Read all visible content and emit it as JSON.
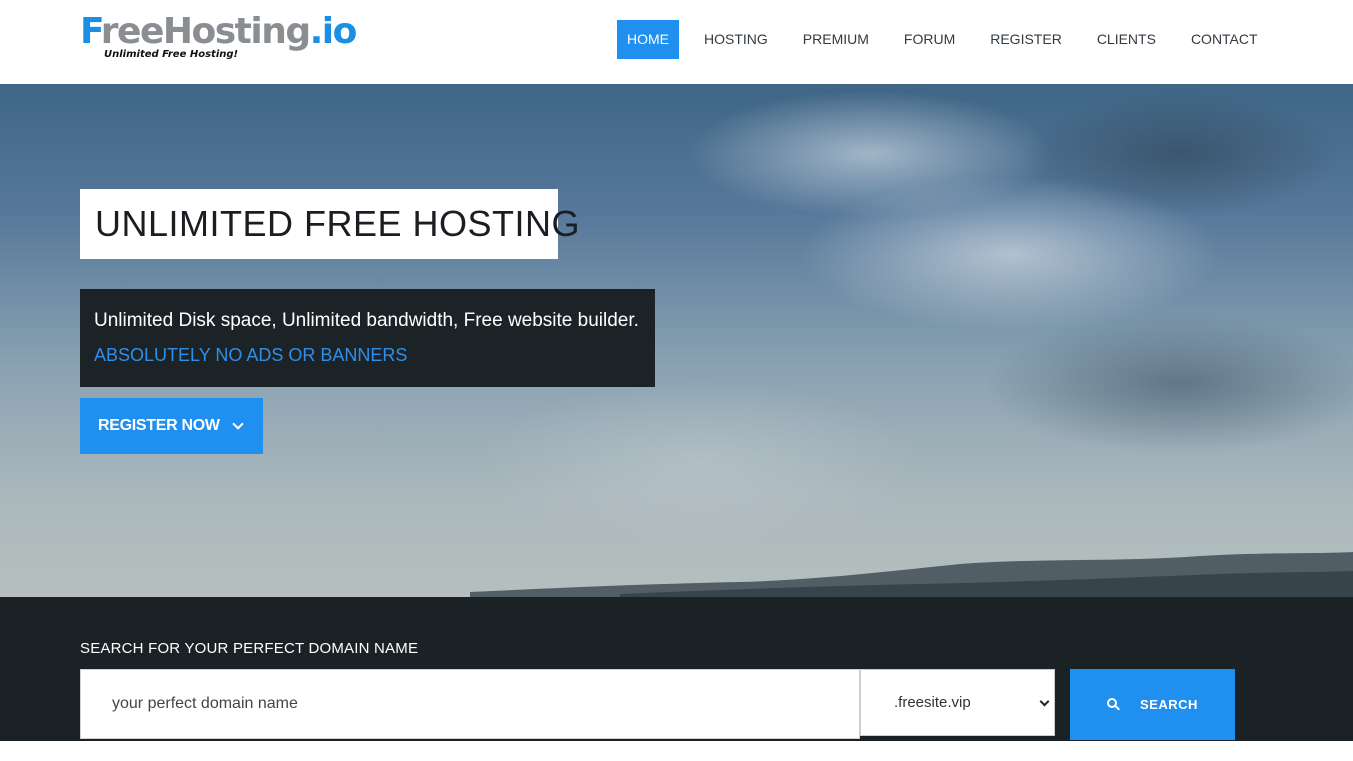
{
  "logo": {
    "f": "F",
    "rest": "reeHosting",
    "io": ".io",
    "tagline": "Unlimited Free Hosting!"
  },
  "nav": [
    {
      "label": "HOME",
      "active": true
    },
    {
      "label": "HOSTING"
    },
    {
      "label": "PREMIUM"
    },
    {
      "label": "FORUM"
    },
    {
      "label": "REGISTER"
    },
    {
      "label": "CLIENTS"
    },
    {
      "label": "CONTACT"
    }
  ],
  "hero": {
    "title": "UNLIMITED FREE HOSTING",
    "features": "Unlimited Disk space, Unlimited bandwidth, Free website builder.",
    "no_ads": "ABSOLUTELY NO ADS OR BANNERS",
    "cta_label": "REGISTER NOW"
  },
  "search": {
    "heading": "SEARCH FOR YOUR PERFECT DOMAIN NAME",
    "placeholder": "your perfect domain name",
    "tld": ".freesite.vip",
    "button_label": "SEARCH"
  },
  "colors": {
    "accent": "#1f8ff0",
    "dark": "#1b2226"
  },
  "icons": [
    "chevron-down-icon",
    "search-icon"
  ]
}
